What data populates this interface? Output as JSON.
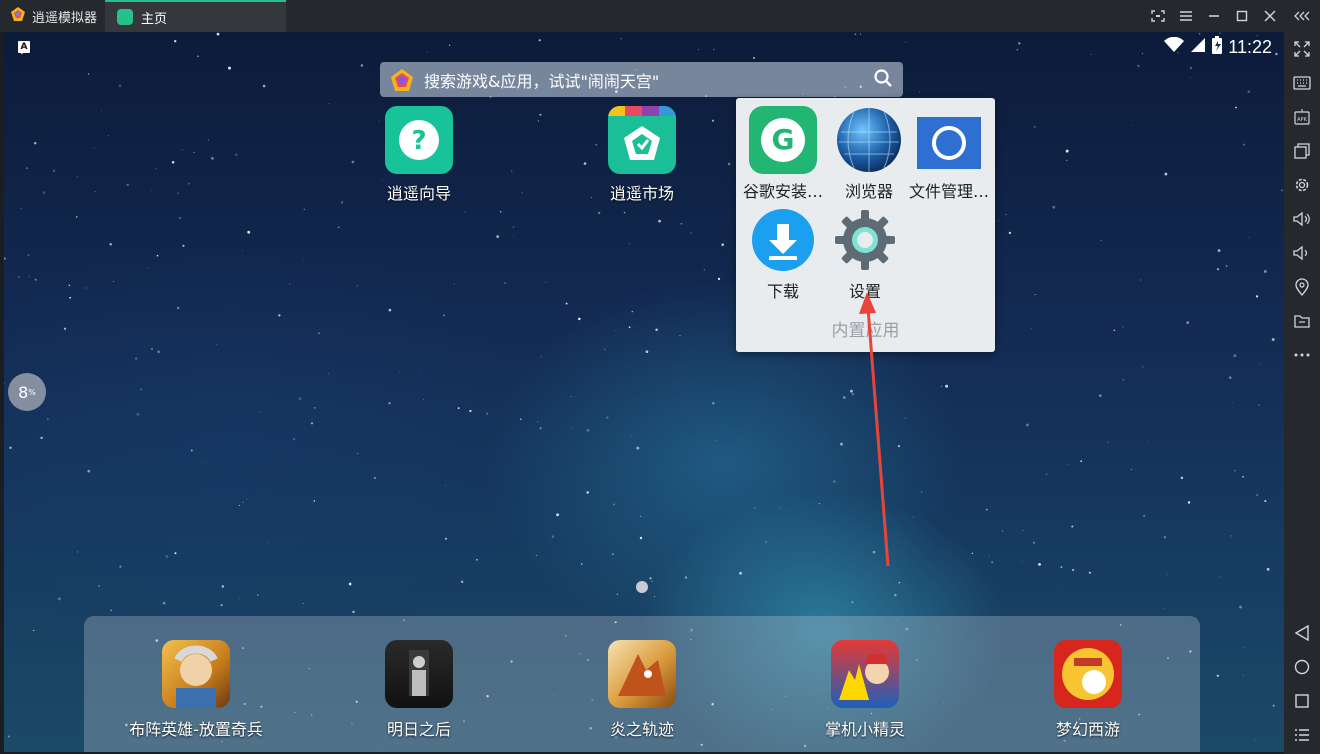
{
  "titlebar": {
    "app_name": "逍遥模拟器",
    "home_tab": "主页"
  },
  "status": {
    "keyboard_badge": "A",
    "time": "11:22"
  },
  "search": {
    "placeholder": "搜索游戏&应用，试试\"闹闹天宫\""
  },
  "desktop_apps": [
    {
      "label": "逍遥向导",
      "icon": "question-icon"
    },
    {
      "label": "逍遥市场",
      "icon": "market-icon"
    }
  ],
  "folder": {
    "title": "内置应用",
    "apps": [
      {
        "label": "谷歌安装…",
        "icon": "google-installer-icon"
      },
      {
        "label": "浏览器",
        "icon": "browser-globe-icon"
      },
      {
        "label": "文件管理…",
        "icon": "file-manager-icon"
      },
      {
        "label": "下载",
        "icon": "download-icon"
      },
      {
        "label": "设置",
        "icon": "settings-gear-icon"
      }
    ]
  },
  "dock": [
    {
      "label": "布阵英雄-放置奇兵"
    },
    {
      "label": "明日之后"
    },
    {
      "label": "炎之轨迹"
    },
    {
      "label": "掌机小精灵"
    },
    {
      "label": "梦幻西游"
    }
  ],
  "float_ball": {
    "value": "8",
    "unit": "%"
  },
  "colors": {
    "accent": "#27c08a",
    "titlebar": "#25282d",
    "annotation_arrow": "#e8443a"
  }
}
